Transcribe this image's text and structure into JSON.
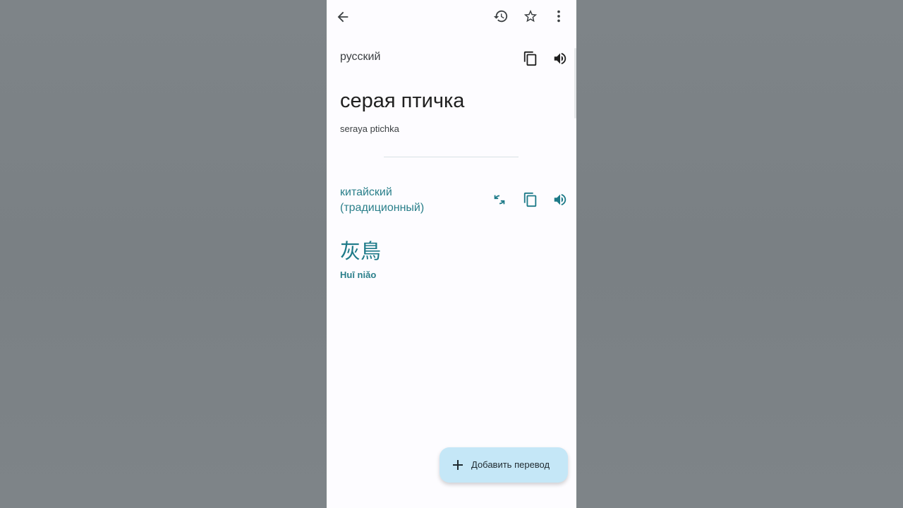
{
  "toolbar": {
    "back_icon": "arrow-back-icon",
    "history_icon": "history-icon",
    "star_icon": "star-icon",
    "menu_icon": "more-vert-icon"
  },
  "source": {
    "language": "русский",
    "text": "серая птичка",
    "transliteration": "seraya ptichka",
    "copy_icon": "copy-icon",
    "speaker_icon": "speaker-icon"
  },
  "target": {
    "language": "китайский (традиционный)",
    "text": "灰鳥",
    "transliteration": "Huī niǎo",
    "swap_icon": "swap-icon",
    "copy_icon": "copy-icon",
    "speaker_icon": "speaker-icon",
    "accent_color": "#1d7a88"
  },
  "fab": {
    "label": "Добавить перевод",
    "icon": "plus-icon",
    "color": "#c5e7f7"
  }
}
